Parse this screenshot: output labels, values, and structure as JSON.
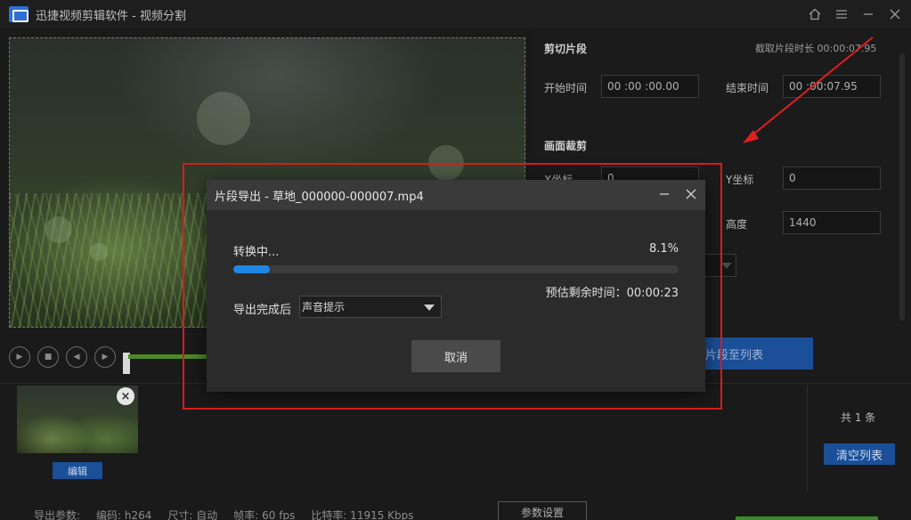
{
  "window": {
    "title": "迅捷视频剪辑软件 - 视频分割",
    "controls": {
      "home_icon": "home-icon",
      "menu_icon": "menu-icon",
      "min_icon": "minimize-icon",
      "close_icon": "close-icon"
    }
  },
  "right_panel": {
    "cut_section_title": "剪切片段",
    "clip_duration": "截取片段时长 00:00:07.95",
    "start_label": "开始时间",
    "start_value": "00 :00 :00.00",
    "end_label": "结束时间",
    "end_value": "00 :00:07.95",
    "crop_section_title": "画面裁剪",
    "x_label": "X坐标",
    "x_value": "0",
    "y_label": "Y坐标",
    "y_value": "0",
    "height_label": "高度",
    "height_value": "1440",
    "add_button": "片段至列表"
  },
  "bottom": {
    "edit_button": "编辑",
    "count": "共 1 条",
    "clear_button": "清空列表",
    "params": {
      "label": "导出参数:",
      "codec": "编码:  h264",
      "size": "尺寸:  自动",
      "fps": "帧率:  60 fps",
      "bitrate": "比特率:  11915 Kbps"
    },
    "param_button": "参数设置"
  },
  "modal": {
    "title": "片段导出 - 草地_000000-000007.mp4",
    "status": "转换中...",
    "percent_text": "8.1%",
    "progress": 8.1,
    "remaining": "预估剩余时间：00:00:23",
    "after_label": "导出完成后",
    "after_value": "声音提示",
    "cancel_button": "取消"
  },
  "colors": {
    "accent": "#1e88e5",
    "brand_blue": "#1b4f98",
    "highlight_red": "#d81b1b"
  }
}
